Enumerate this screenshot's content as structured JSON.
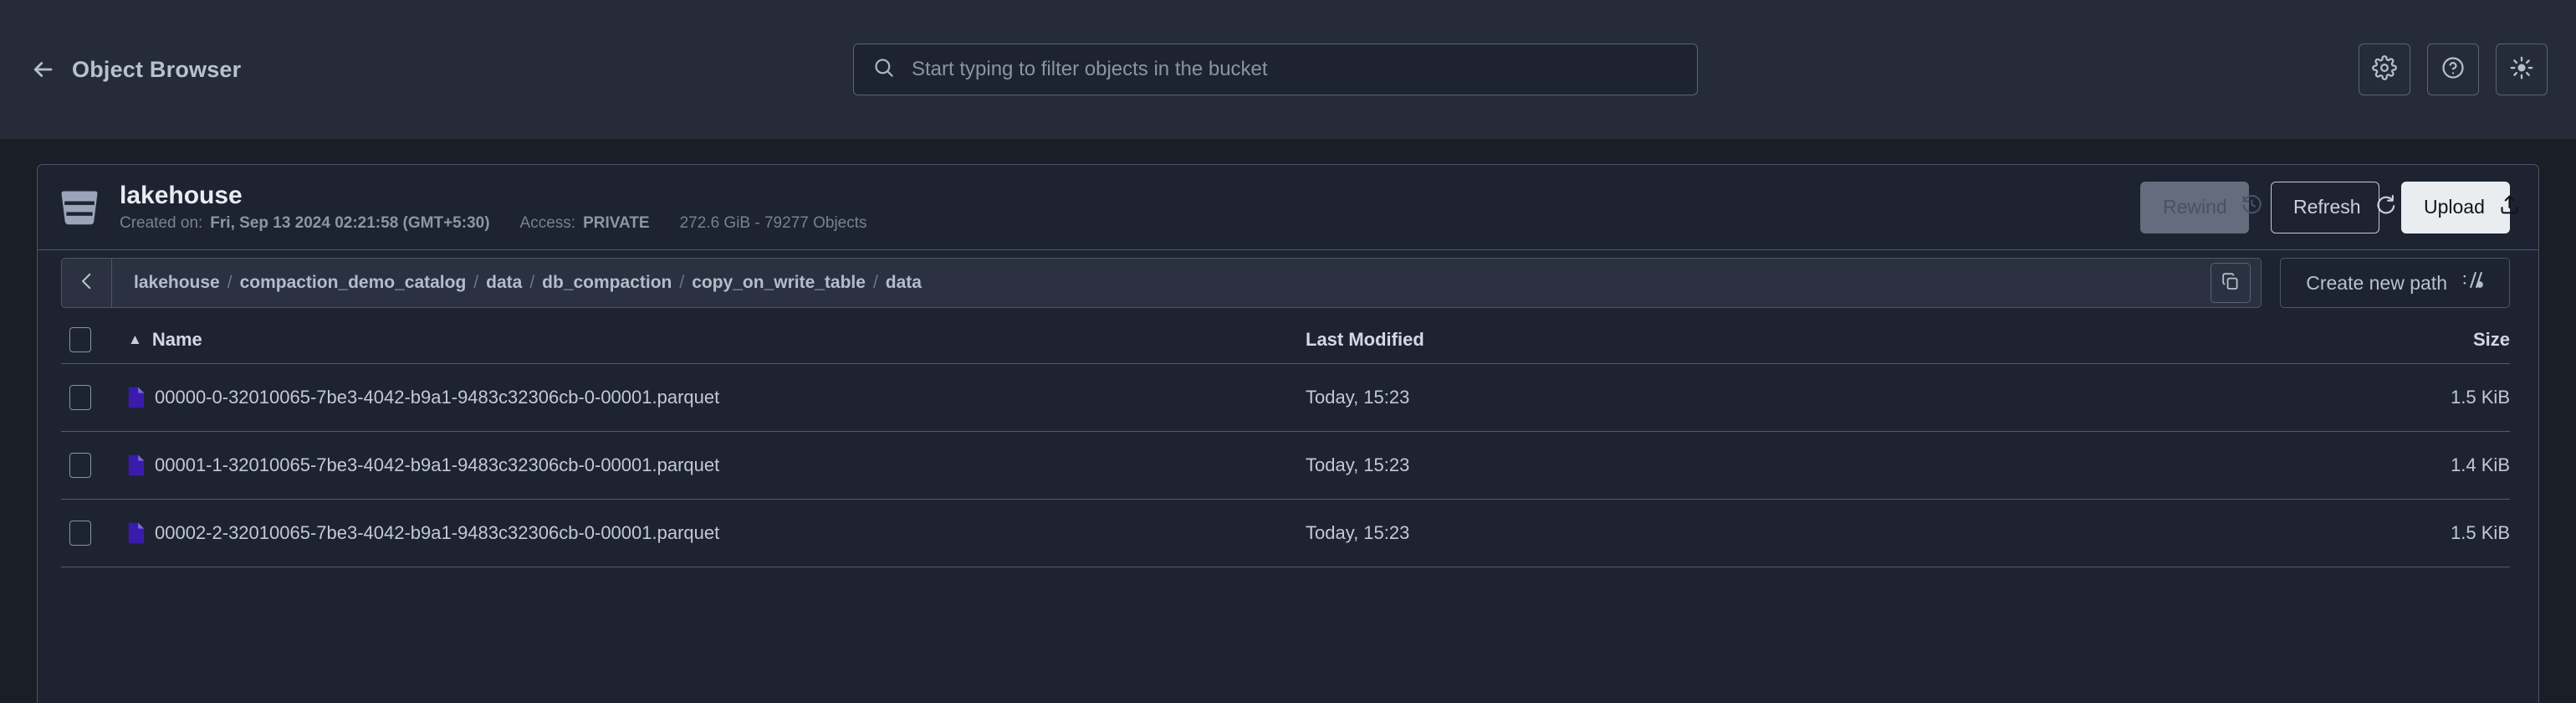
{
  "header": {
    "back_icon": "arrow-left-icon",
    "title": "Object Browser",
    "search": {
      "icon": "search-icon",
      "placeholder": "Start typing to filter objects in the bucket",
      "value": ""
    },
    "actions": [
      {
        "icon": "gear-icon",
        "name": "settings-button"
      },
      {
        "icon": "help-circle-icon",
        "name": "help-button"
      },
      {
        "icon": "sun-icon",
        "name": "theme-toggle-button"
      }
    ]
  },
  "bucket": {
    "icon": "bucket-icon",
    "name": "lakehouse",
    "created_label": "Created on:",
    "created_value": "Fri, Sep 13 2024 02:21:58 (GMT+5:30)",
    "access_label": "Access:",
    "access_value": "PRIVATE",
    "stats": "272.6 GiB - 79277 Objects",
    "buttons": {
      "rewind": {
        "label": "Rewind",
        "icon": "rewind-clock-icon",
        "disabled": true
      },
      "refresh": {
        "label": "Refresh",
        "icon": "refresh-icon",
        "disabled": false
      },
      "upload": {
        "label": "Upload",
        "icon": "upload-icon",
        "disabled": false
      }
    }
  },
  "breadcrumb": {
    "back_icon": "chevron-left-icon",
    "copy_icon": "copy-icon",
    "segments": [
      "lakehouse",
      "compaction_demo_catalog",
      "data",
      "db_compaction",
      "copy_on_write_table",
      "data"
    ],
    "separator": "/",
    "create_path_label": "Create new path",
    "create_path_icon": "new-path-icon"
  },
  "table": {
    "columns": {
      "name": "Name",
      "last_modified": "Last Modified",
      "size": "Size"
    },
    "sort_column": "Name",
    "sort_direction": "asc",
    "sort_caret": "▲",
    "select_all_checked": false,
    "rows": [
      {
        "checked": false,
        "icon": "parquet-file-icon",
        "name": "00000-0-32010065-7be3-4042-b9a1-9483c32306cb-0-00001.parquet",
        "last_modified": "Today, 15:23",
        "size": "1.5 KiB"
      },
      {
        "checked": false,
        "icon": "parquet-file-icon",
        "name": "00001-1-32010065-7be3-4042-b9a1-9483c32306cb-0-00001.parquet",
        "last_modified": "Today, 15:23",
        "size": "1.4 KiB"
      },
      {
        "checked": false,
        "icon": "parquet-file-icon",
        "name": "00002-2-32010065-7be3-4042-b9a1-9483c32306cb-0-00001.parquet",
        "last_modified": "Today, 15:23",
        "size": "1.5 KiB"
      }
    ]
  },
  "colors": {
    "page_bg": "#191e27",
    "topbar_bg": "#252b38",
    "panel_bg": "#1d2330",
    "border": "#4c5568",
    "text_primary": "#d3d9e3",
    "text_muted": "#79818f",
    "file_icon_accent": "#3a1bab",
    "upload_bg": "#e9edf0",
    "rewind_disabled_bg": "#646c7e"
  }
}
